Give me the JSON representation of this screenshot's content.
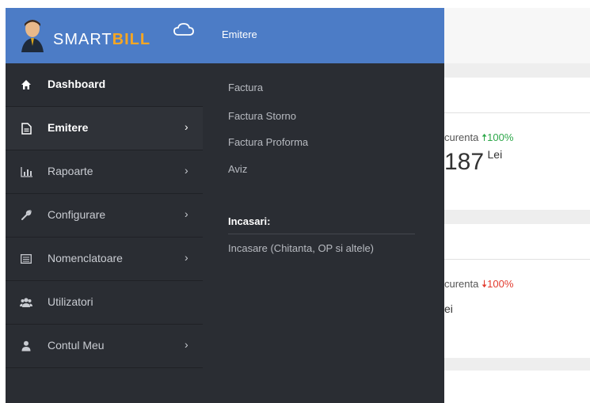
{
  "brand": {
    "smart": "SMART",
    "bill": "BILL"
  },
  "sidebar": {
    "items": [
      {
        "label": "Dashboard",
        "icon": "home-icon",
        "glyph": "🏠",
        "chevron": ""
      },
      {
        "label": "Emitere",
        "icon": "document-icon",
        "glyph": "🗎",
        "chevron": "›"
      },
      {
        "label": "Rapoarte",
        "icon": "bar-chart-icon",
        "glyph": "",
        "chevron": "›"
      },
      {
        "label": "Configurare",
        "icon": "wrench-icon",
        "glyph": "🔧",
        "chevron": "›"
      },
      {
        "label": "Nomenclatoare",
        "icon": "list-icon",
        "glyph": "",
        "chevron": "›"
      },
      {
        "label": "Utilizatori",
        "icon": "users-icon",
        "glyph": "👥",
        "chevron": ""
      },
      {
        "label": "Contul Meu",
        "icon": "user-icon",
        "glyph": "👤",
        "chevron": "›"
      }
    ]
  },
  "submenu": {
    "title": "Emitere",
    "links": [
      "Factura",
      "Factura Storno",
      "Factura Proforma",
      "Aviz"
    ],
    "section_title": "Incasari:",
    "section_link": "Incasare (Chitanta, OP si altele)"
  },
  "content": {
    "card1": {
      "trend_label": "curenta",
      "arrow": "🠅",
      "pct": "100%",
      "value": "187",
      "unit": "Lei"
    },
    "card2": {
      "trend_label": "curenta",
      "arrow": "🠇",
      "pct": "100%",
      "unit": "ei"
    }
  },
  "colors": {
    "accent": "#4c7cc6",
    "sidebar": "#2a2d33",
    "brand_orange": "#f5a623",
    "up": "#2ea84a",
    "down": "#e23b2e"
  }
}
